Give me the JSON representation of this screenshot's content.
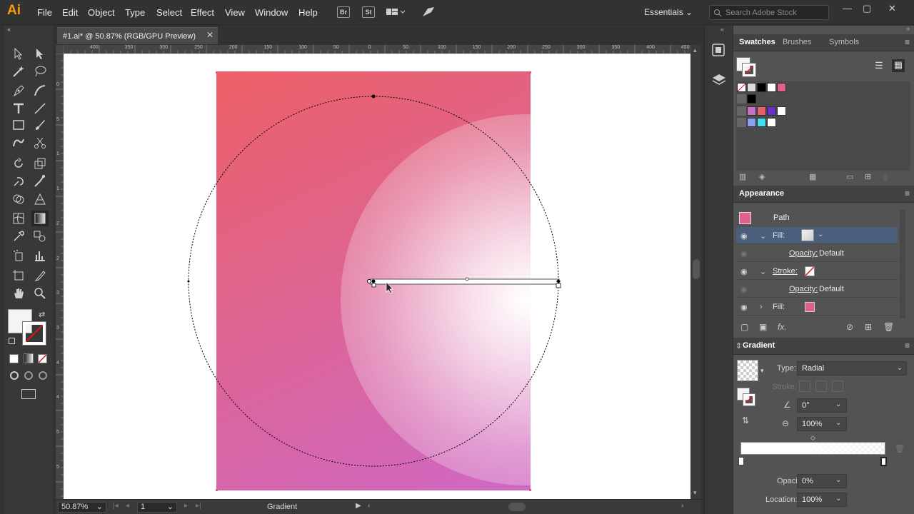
{
  "app": {
    "logo": "Ai"
  },
  "menu": [
    "File",
    "Edit",
    "Object",
    "Type",
    "Select",
    "Effect",
    "View",
    "Window",
    "Help"
  ],
  "topbar": {
    "br": "Br",
    "st": "St",
    "workspace": "Essentials",
    "search_placeholder": "Search Adobe Stock"
  },
  "document": {
    "tab_title": "#1.ai* @ 50.87% (RGB/GPU Preview)"
  },
  "ruler_top": [
    "400",
    "350",
    "300",
    "250",
    "200",
    "150",
    "100",
    "50",
    "0",
    "50",
    "100",
    "150",
    "200",
    "250",
    "300",
    "350",
    "400",
    "450"
  ],
  "ruler_left": [
    "0",
    "5",
    "1",
    "1",
    "2",
    "2",
    "3",
    "3",
    "4",
    "4",
    "5",
    "5",
    "6"
  ],
  "status": {
    "zoom": "50.87%",
    "page": "1",
    "tool": "Gradient"
  },
  "swatches_panel": {
    "tabs": [
      "Swatches",
      "Brushes",
      "Symbols"
    ]
  },
  "appearance_panel": {
    "title": "Appearance",
    "object": "Path",
    "rows": [
      {
        "label": "Fill:",
        "value": ""
      },
      {
        "label": "Opacity:",
        "value": "Default"
      },
      {
        "label": "Stroke:",
        "value": ""
      },
      {
        "label": "Opacity:",
        "value": "Default"
      },
      {
        "label": "Fill:",
        "value": ""
      }
    ]
  },
  "gradient_panel": {
    "title": "Gradient",
    "type_label": "Type:",
    "type_value": "Radial",
    "stroke_label": "Stroke:",
    "angle": "0°",
    "aspect": "100%",
    "opacity_label": "Opacity:",
    "opacity": "0%",
    "location_label": "Location:",
    "location": "100%"
  },
  "colors": {
    "accent": "#ff9a00",
    "artboard_top": "#ec6066",
    "artboard_bottom": "#cf68c4",
    "fill_swatch": "#e06090",
    "selected_row": "#4b5f7d"
  }
}
